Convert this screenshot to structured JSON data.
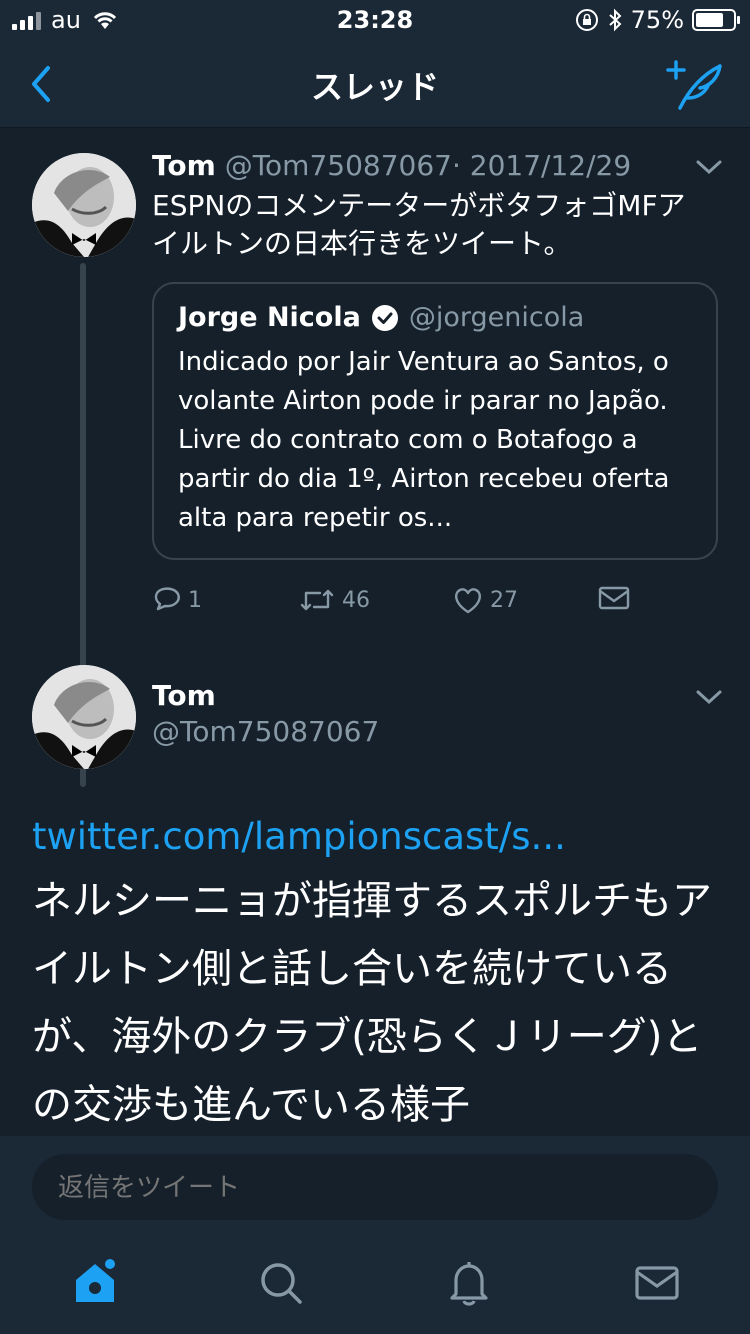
{
  "status_bar": {
    "carrier": "au",
    "time": "23:28",
    "battery": "75%",
    "battery_level": 0.75
  },
  "nav": {
    "title": "スレッド"
  },
  "tweet1": {
    "name": "Tom",
    "handle": "@Tom75087067",
    "date": "· 2017/12/29",
    "text": "ESPNのコメンテーターがボタフォゴMFアイルトンの日本行きをツイート。",
    "quote": {
      "name": "Jorge Nicola",
      "handle": "@jorgenicola",
      "text": "Indicado por Jair Ventura ao Santos, o volante Airton pode ir parar no Japão. Livre do contrato com o Botafogo a partir do dia 1º, Airton recebeu oferta alta para repetir os..."
    },
    "actions": {
      "replies": "1",
      "retweets": "46",
      "likes": "27"
    }
  },
  "tweet2": {
    "name": "Tom",
    "handle": "@Tom75087067",
    "link": "twitter.com/lampionscast/s...",
    "text": "ネルシーニョが指揮するスポルチもアイルトン側と話し合いを続けているが、海外のクラブ(恐らくＪリーグ)との交渉も進んでいる様子"
  },
  "reply": {
    "placeholder": "返信をツイート"
  },
  "colors": {
    "background": "#15202b",
    "bar": "#1b2836",
    "accent": "#1da1f2",
    "muted": "#8899a6"
  },
  "icons": {
    "nav_back": "chevron-left-icon",
    "nav_compose": "compose-tweet-icon",
    "tabs": [
      "home-icon",
      "search-icon",
      "notifications-icon",
      "messages-icon"
    ]
  }
}
